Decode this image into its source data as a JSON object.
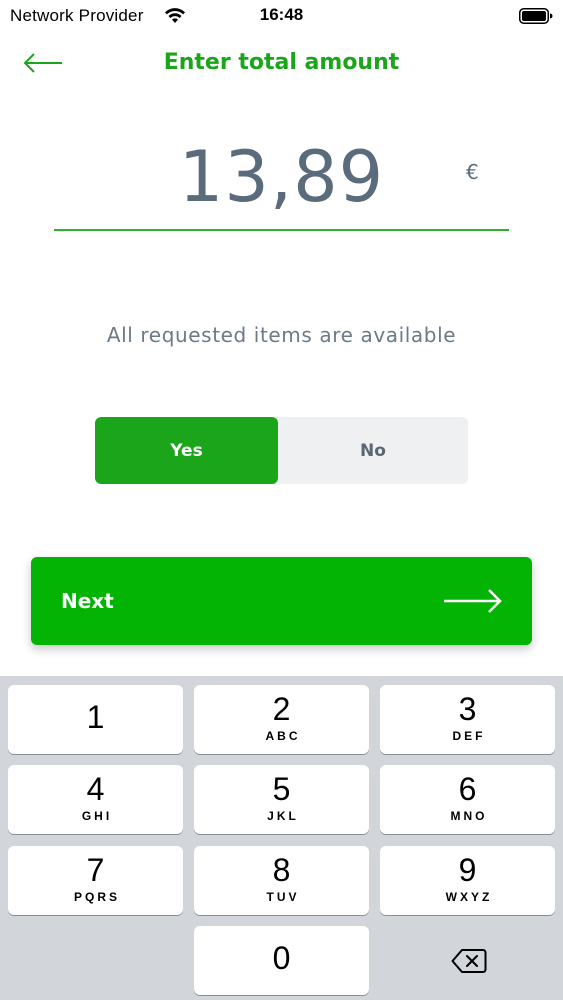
{
  "status_bar": {
    "carrier": "Network Provider",
    "time": "16:48",
    "wifi_icon": "wifi-icon",
    "battery_icon": "battery-icon"
  },
  "nav": {
    "title": "Enter total amount",
    "back_icon": "arrow-left-icon"
  },
  "amount": {
    "value": "13,89",
    "currency": "€"
  },
  "availability": {
    "text": "All requested items are available"
  },
  "toggle": {
    "options": [
      "Yes",
      "No"
    ],
    "selected": "Yes"
  },
  "next_button": {
    "label": "Next",
    "icon": "arrow-right-icon"
  },
  "colors": {
    "accent_green": "#1aa51a",
    "button_green": "#04b404",
    "text_grey": "#5a6b7b"
  },
  "keypad": {
    "keys": [
      {
        "digit": "1",
        "letters": ""
      },
      {
        "digit": "2",
        "letters": "ABC"
      },
      {
        "digit": "3",
        "letters": "DEF"
      },
      {
        "digit": "4",
        "letters": "GHI"
      },
      {
        "digit": "5",
        "letters": "JKL"
      },
      {
        "digit": "6",
        "letters": "MNO"
      },
      {
        "digit": "7",
        "letters": "PQRS"
      },
      {
        "digit": "8",
        "letters": "TUV"
      },
      {
        "digit": "9",
        "letters": "WXYZ"
      },
      {
        "digit": "0",
        "letters": ""
      }
    ],
    "delete_icon": "backspace-icon"
  }
}
